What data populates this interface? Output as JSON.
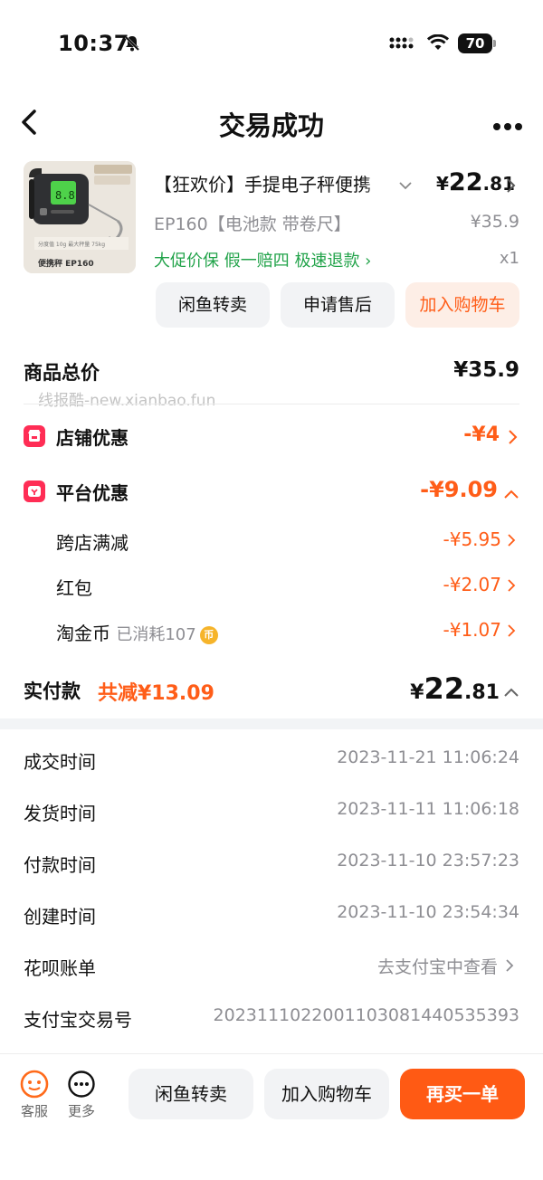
{
  "status": {
    "time": "10:37",
    "battery": "70"
  },
  "nav": {
    "title": "交易成功"
  },
  "product": {
    "name": "【狂欢价】手提电子秤便携",
    "price_symbol": "¥",
    "price_int": "22",
    "price_dec": ".81",
    "spec": "EP160【电池款 带卷尺】",
    "original_price": "¥35.9",
    "tags": "大促价保  假一赔四  极速退款 ›",
    "quantity": "x1",
    "thumb_label": "便携秤 EP160",
    "buttons": [
      "闲鱼转卖",
      "申请售后",
      "加入购物车"
    ]
  },
  "summary": {
    "goods_total_label": "商品总价",
    "goods_total": "¥35.9",
    "watermark": "线报酷-new.xianbao.fun",
    "shop_discount_label": "店铺优惠",
    "shop_discount": "-¥4",
    "platform_discount_label": "平台优惠",
    "platform_discount": "-¥9.09",
    "sub_items": [
      {
        "label": "跨店满减",
        "note": "",
        "value": "-¥5.95"
      },
      {
        "label": "红包",
        "note": "",
        "value": "-¥2.07"
      },
      {
        "label": "淘金币",
        "note": "已消耗107",
        "value": "-¥1.07"
      }
    ],
    "coin_icon": "币",
    "paid_label": "实付款",
    "saved": "共减¥13.09",
    "paid_symbol": "¥",
    "paid_int": "22",
    "paid_dec": ".81"
  },
  "info": [
    {
      "label": "成交时间",
      "value": "2023-11-21 11:06:24"
    },
    {
      "label": "发货时间",
      "value": "2023-11-11 11:06:18"
    },
    {
      "label": "付款时间",
      "value": "2023-11-10 23:57:23"
    },
    {
      "label": "创建时间",
      "value": "2023-11-10 23:54:34"
    },
    {
      "label": "花呗账单",
      "value": "去支付宝中查看"
    },
    {
      "label": "支付宝交易号",
      "value": "2023111022001103081440535393"
    }
  ],
  "bottom": {
    "service_label": "客服",
    "more_label": "更多",
    "resell": "闲鱼转卖",
    "add_cart": "加入购物车",
    "rebuy": "再买一单"
  },
  "colors": {
    "accent": "#ff5d18",
    "green": "#22a34a",
    "badge": "#ff2d55"
  }
}
